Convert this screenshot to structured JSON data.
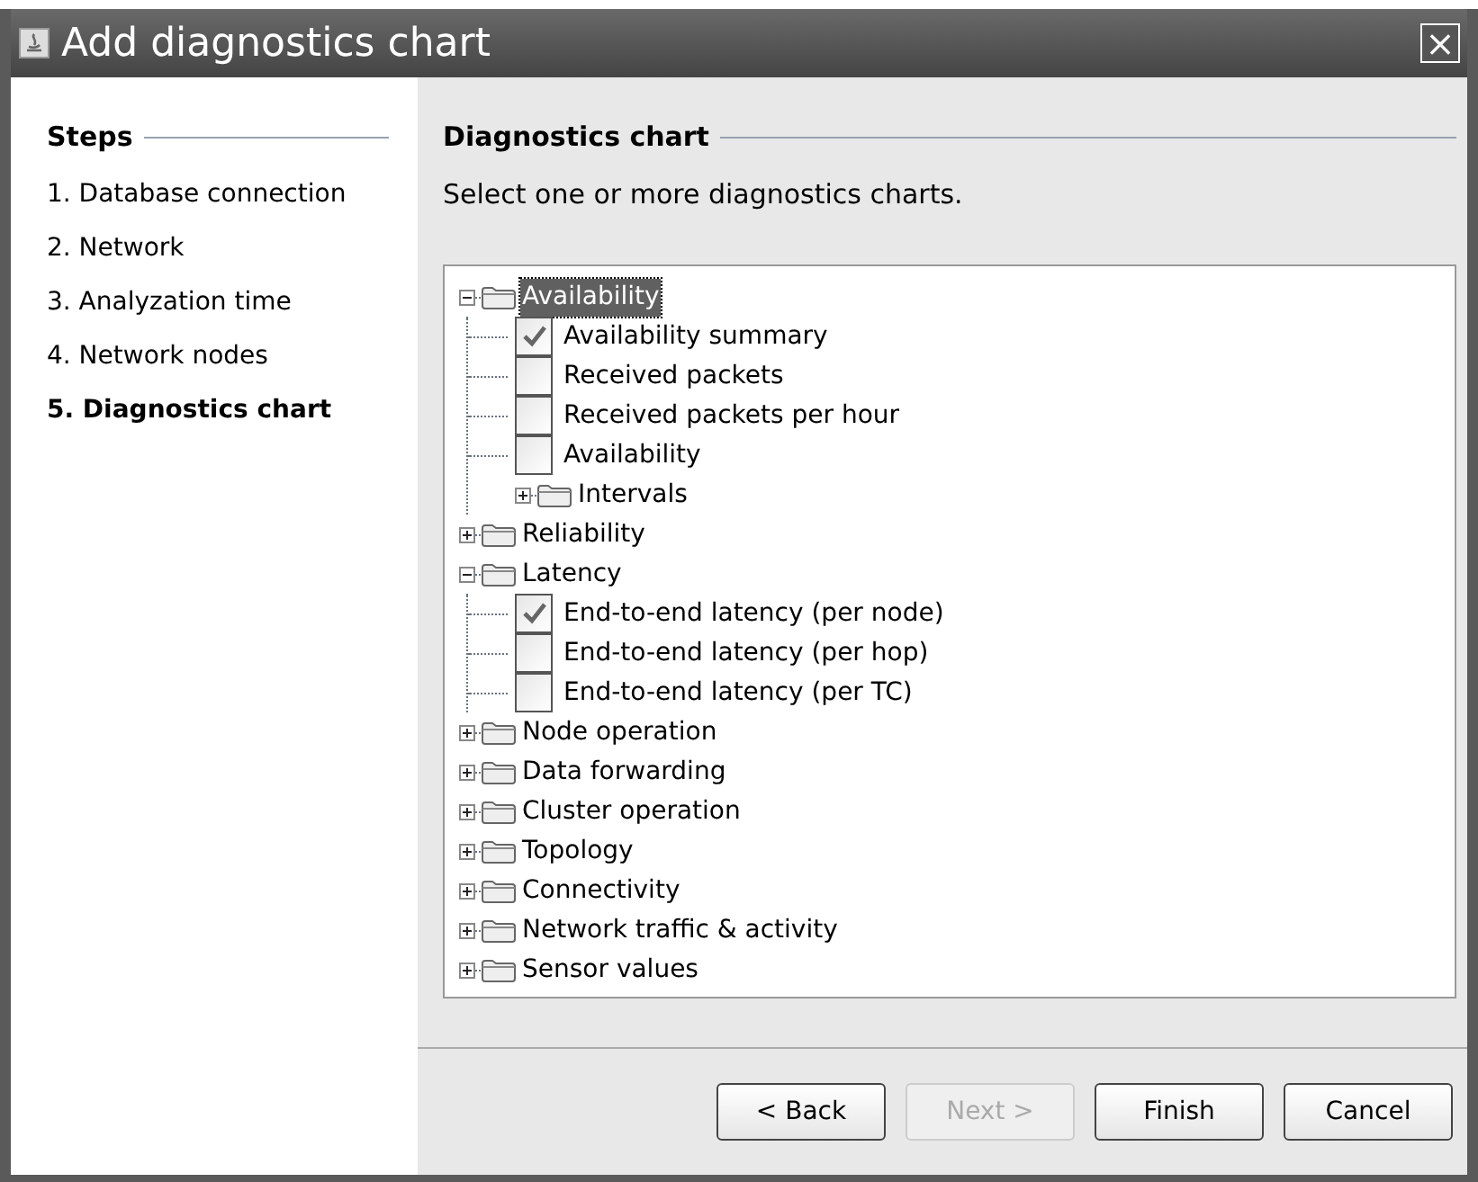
{
  "window": {
    "title": "Add diagnostics chart",
    "close": "×"
  },
  "steps": {
    "title": "Steps",
    "items": [
      {
        "label": "1. Database connection",
        "selected": false
      },
      {
        "label": "2. Network",
        "selected": false
      },
      {
        "label": "3. Analyzation time",
        "selected": false
      },
      {
        "label": "4. Network nodes",
        "selected": false
      },
      {
        "label": "5. Diagnostics chart",
        "selected": true
      }
    ]
  },
  "content": {
    "title": "Diagnostics chart",
    "description": "Select one or more diagnostics charts."
  },
  "tree": [
    {
      "kind": "folder",
      "label": "Availability",
      "expanded": true,
      "selected": true,
      "children": [
        {
          "kind": "check",
          "label": "Availability summary",
          "checked": true
        },
        {
          "kind": "check",
          "label": "Received packets",
          "checked": false
        },
        {
          "kind": "check",
          "label": "Received packets per hour",
          "checked": false
        },
        {
          "kind": "check",
          "label": "Availability",
          "checked": false
        },
        {
          "kind": "folder",
          "label": "Intervals",
          "expanded": false,
          "selected": false
        }
      ]
    },
    {
      "kind": "folder",
      "label": "Reliability",
      "expanded": false,
      "selected": false
    },
    {
      "kind": "folder",
      "label": "Latency",
      "expanded": true,
      "selected": false,
      "children": [
        {
          "kind": "check",
          "label": "End-to-end latency (per node)",
          "checked": true
        },
        {
          "kind": "check",
          "label": "End-to-end latency (per hop)",
          "checked": false
        },
        {
          "kind": "check",
          "label": "End-to-end latency (per TC)",
          "checked": false
        }
      ]
    },
    {
      "kind": "folder",
      "label": "Node operation",
      "expanded": false,
      "selected": false
    },
    {
      "kind": "folder",
      "label": "Data forwarding",
      "expanded": false,
      "selected": false
    },
    {
      "kind": "folder",
      "label": "Cluster operation",
      "expanded": false,
      "selected": false
    },
    {
      "kind": "folder",
      "label": "Topology",
      "expanded": false,
      "selected": false
    },
    {
      "kind": "folder",
      "label": "Connectivity",
      "expanded": false,
      "selected": false
    },
    {
      "kind": "folder",
      "label": "Network traffic & activity",
      "expanded": false,
      "selected": false
    },
    {
      "kind": "folder",
      "label": "Sensor values",
      "expanded": false,
      "selected": false
    }
  ],
  "buttons": [
    {
      "label": "< Back",
      "disabled": false
    },
    {
      "label": "Next >",
      "disabled": true
    },
    {
      "label": "Finish",
      "disabled": false
    },
    {
      "label": "Cancel",
      "disabled": false
    }
  ]
}
